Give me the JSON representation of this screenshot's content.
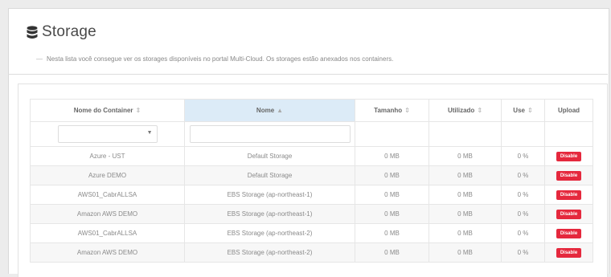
{
  "page": {
    "title": "Storage",
    "description_dash": "—",
    "description": "Nesta lista você consegue ver os storages disponíveis no portal Multi-Cloud. Os storages estão anexados nos containers.",
    "icon": "database-icon"
  },
  "table": {
    "columns": [
      {
        "label": "Nome do Container",
        "sort": "⇕"
      },
      {
        "label": "Nome",
        "sort": "▲"
      },
      {
        "label": "Tamanho",
        "sort": "⇕"
      },
      {
        "label": "Utilizado",
        "sort": "⇕"
      },
      {
        "label": "Use",
        "sort": "⇕"
      },
      {
        "label": "Upload",
        "sort": ""
      }
    ],
    "filter": {
      "container_select_caret": "▼"
    },
    "rows": [
      {
        "container": "Azure - UST",
        "name": "Default Storage",
        "size": "0 MB",
        "used": "0 MB",
        "use": "0 %",
        "upload": "Disable"
      },
      {
        "container": "Azure DEMO",
        "name": "Default Storage",
        "size": "0 MB",
        "used": "0 MB",
        "use": "0 %",
        "upload": "Disable"
      },
      {
        "container": "AWS01_CabrALLSA",
        "name": "EBS Storage (ap-northeast-1)",
        "size": "0 MB",
        "used": "0 MB",
        "use": "0 %",
        "upload": "Disable"
      },
      {
        "container": "Amazon AWS DEMO",
        "name": "EBS Storage (ap-northeast-1)",
        "size": "0 MB",
        "used": "0 MB",
        "use": "0 %",
        "upload": "Disable"
      },
      {
        "container": "AWS01_CabrALLSA",
        "name": "EBS Storage (ap-northeast-2)",
        "size": "0 MB",
        "used": "0 MB",
        "use": "0 %",
        "upload": "Disable"
      },
      {
        "container": "Amazon AWS DEMO",
        "name": "EBS Storage (ap-northeast-2)",
        "size": "0 MB",
        "used": "0 MB",
        "use": "0 %",
        "upload": "Disable"
      }
    ]
  },
  "colors": {
    "accent_sorted": "#dcebf7",
    "disable_button": "#e5283d"
  }
}
